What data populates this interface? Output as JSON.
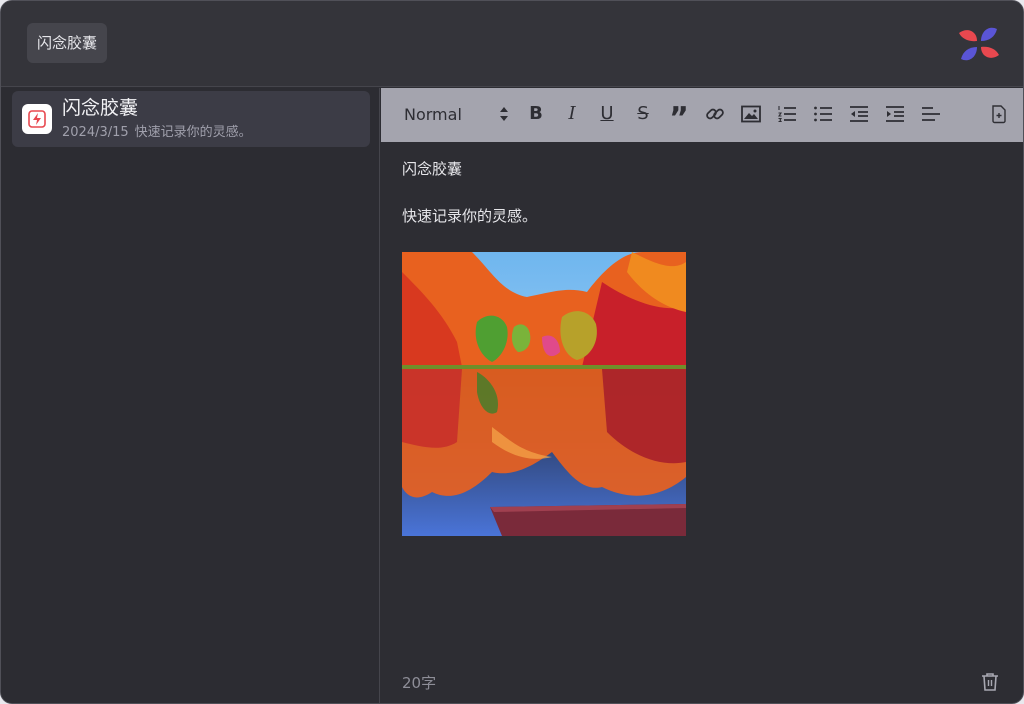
{
  "header": {
    "app_button_label": "闪念胶囊",
    "logo_colors": {
      "red": "#e8484f",
      "blue": "#5a55d6"
    }
  },
  "sidebar": {
    "notes": [
      {
        "title": "闪念胶囊",
        "date": "2024/3/15",
        "preview": "快速记录你的灵感。",
        "icon": "flash-capsule-icon",
        "selected": true
      }
    ]
  },
  "toolbar": {
    "style_select_value": "Normal",
    "buttons": [
      {
        "name": "bold",
        "icon": "bold-icon",
        "glyph": "B"
      },
      {
        "name": "italic",
        "icon": "italic-icon",
        "glyph": "I"
      },
      {
        "name": "underline",
        "icon": "underline-icon",
        "glyph": "U"
      },
      {
        "name": "strikethrough",
        "icon": "strikethrough-icon",
        "glyph": "S"
      },
      {
        "name": "blockquote",
        "icon": "quote-icon",
        "glyph": "”"
      },
      {
        "name": "link",
        "icon": "link-icon"
      },
      {
        "name": "image",
        "icon": "image-icon"
      },
      {
        "name": "ordered-list",
        "icon": "ordered-list-icon"
      },
      {
        "name": "bullet-list",
        "icon": "bullet-list-icon"
      },
      {
        "name": "outdent",
        "icon": "outdent-icon"
      },
      {
        "name": "indent",
        "icon": "indent-icon"
      },
      {
        "name": "align",
        "icon": "align-icon"
      },
      {
        "name": "add-page",
        "icon": "add-page-icon"
      }
    ],
    "background": "#a4a4ae"
  },
  "editor": {
    "paragraphs": [
      "闪念胶囊",
      "快速记录你的灵感。"
    ],
    "image": {
      "icon": "autumn-lake-image",
      "description_colors": [
        "#e8611f",
        "#88c6f0",
        "#7a2a3a"
      ]
    },
    "word_count": "20字"
  },
  "colors": {
    "window_bg": "#2d2d33",
    "header_bg": "#34343a",
    "selected_item_bg": "#3c3c46",
    "text_primary": "#e6e6ea",
    "text_muted": "#8e8e98"
  }
}
